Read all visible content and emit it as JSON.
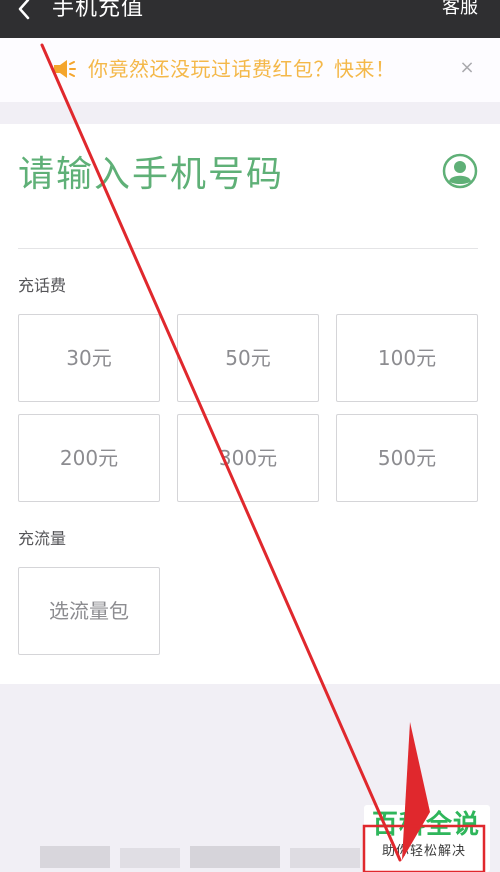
{
  "titlebar": {
    "title": "手机充值",
    "service": "客服",
    "back_icon": "chevron-left-icon"
  },
  "notice": {
    "text": "你竟然还没玩过话费红包？快来！",
    "close": "×",
    "icon": "speaker-icon"
  },
  "phone": {
    "placeholder": "请输入手机号码",
    "contact_icon": "contact-person-icon"
  },
  "sections": {
    "call_credit_label": "充话费",
    "data_label": "充流量"
  },
  "call_credit_options": [
    "30元",
    "50元",
    "100元",
    "200元",
    "300元",
    "500元"
  ],
  "data_option": "选流量包",
  "watermark": {
    "title": "百科全说",
    "subtitle": "助你轻松解决"
  },
  "colors": {
    "titlebar_bg": "#2f2f31",
    "accent_green": "#5fb077",
    "notice_text": "#f4b849",
    "annotation_red": "#e0282d"
  }
}
